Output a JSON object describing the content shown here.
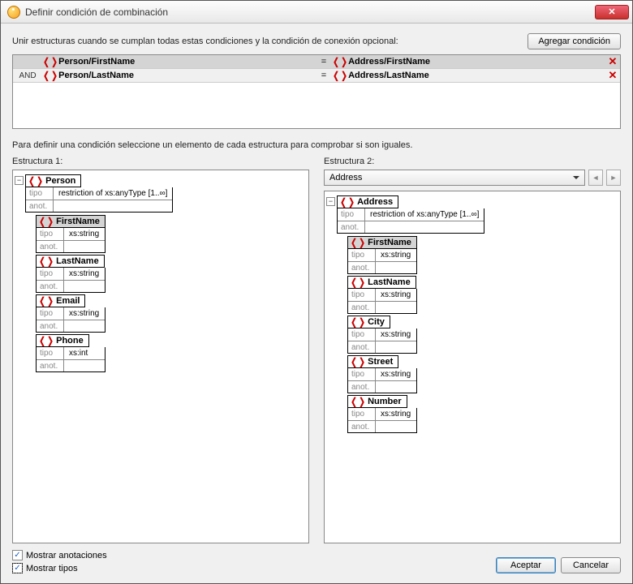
{
  "title": "Definir condición de combinación",
  "instruction_top": "Unir estructuras cuando se cumplan todas estas condiciones y la condición de conexión opcional:",
  "add_condition": "Agregar condición",
  "conditions": [
    {
      "op": "",
      "left": "Person/FirstName",
      "eq": "=",
      "right": "Address/FirstName"
    },
    {
      "op": "AND",
      "left": "Person/LastName",
      "eq": "=",
      "right": "Address/LastName"
    }
  ],
  "instruction_mid": "Para definir una condición seleccione un elemento de cada estructura para comprobar si son iguales.",
  "label_struct1": "Estructura 1:",
  "label_struct2": "Estructura 2:",
  "dropdown2_value": "Address",
  "tipo_label": "tipo",
  "anot_label": "anot.",
  "tree1": {
    "name": "Person",
    "tipo": "restriction of xs:anyType [1..∞]",
    "children": [
      {
        "name": "FirstName",
        "tipo": "xs:string",
        "sel": true
      },
      {
        "name": "LastName",
        "tipo": "xs:string"
      },
      {
        "name": "Email",
        "tipo": "xs:string"
      },
      {
        "name": "Phone",
        "tipo": "xs:int"
      }
    ]
  },
  "tree2": {
    "name": "Address",
    "tipo": "restriction of xs:anyType [1..∞]",
    "children": [
      {
        "name": "FirstName",
        "tipo": "xs:string",
        "sel": true
      },
      {
        "name": "LastName",
        "tipo": "xs:string"
      },
      {
        "name": "City",
        "tipo": "xs:string"
      },
      {
        "name": "Street",
        "tipo": "xs:string"
      },
      {
        "name": "Number",
        "tipo": "xs:string"
      }
    ]
  },
  "show_annotations": "Mostrar anotaciones",
  "show_types": "Mostrar tipos",
  "accept": "Aceptar",
  "cancel": "Cancelar"
}
